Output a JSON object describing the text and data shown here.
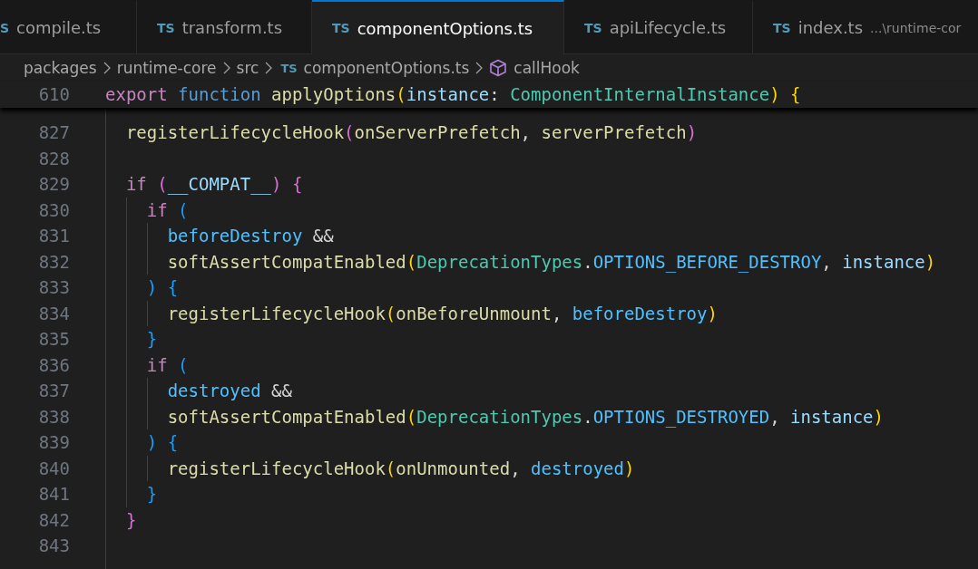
{
  "tabs": [
    {
      "icon": "S",
      "label": "compile.ts",
      "selected": false
    },
    {
      "icon": "TS",
      "label": "transform.ts",
      "selected": false
    },
    {
      "icon": "TS",
      "label": "componentOptions.ts",
      "selected": true
    },
    {
      "icon": "TS",
      "label": "apiLifecycle.ts",
      "selected": false
    },
    {
      "icon": "TS",
      "label": "index.ts",
      "description": "...\\runtime-cor",
      "selected": false
    }
  ],
  "breadcrumbs": [
    {
      "kind": "folder",
      "label": "packages"
    },
    {
      "kind": "folder",
      "label": "runtime-core"
    },
    {
      "kind": "folder",
      "label": "src"
    },
    {
      "kind": "file",
      "icon": "TS",
      "label": "componentOptions.ts"
    },
    {
      "kind": "symbol",
      "label": "callHook"
    }
  ],
  "sticky_line": {
    "number": "610",
    "tokens": [
      {
        "text": "export",
        "kind": "keyword"
      },
      {
        "text": " function",
        "kind": "storage"
      },
      {
        "text": " applyOptions",
        "kind": "function"
      },
      {
        "text": "(",
        "kind": "bracket1"
      },
      {
        "text": "instance",
        "kind": "variable"
      },
      {
        "text": ": ",
        "kind": "plain"
      },
      {
        "text": "ComponentInternalInstance",
        "kind": "type"
      },
      {
        "text": ")",
        "kind": "bracket1"
      },
      {
        "text": " {",
        "kind": "bracket1"
      }
    ]
  },
  "lines": [
    {
      "number": "827",
      "tokens": [
        {
          "text": "  registerLifecycleHook",
          "kind": "function"
        },
        {
          "text": "(",
          "kind": "bracket2"
        },
        {
          "text": "onServerPrefetch",
          "kind": "function"
        },
        {
          "text": ", ",
          "kind": "plain"
        },
        {
          "text": "serverPrefetch",
          "kind": "function"
        },
        {
          "text": ")",
          "kind": "bracket2"
        }
      ]
    },
    {
      "number": "828"
    },
    {
      "number": "829",
      "tokens": [
        {
          "text": "  if",
          "kind": "keyword"
        },
        {
          "text": " (",
          "kind": "bracket2"
        },
        {
          "text": "__COMPAT__",
          "kind": "variable"
        },
        {
          "text": ")",
          "kind": "bracket2"
        },
        {
          "text": " {",
          "kind": "bracket2"
        }
      ]
    },
    {
      "number": "830",
      "tokens": [
        {
          "text": "    if",
          "kind": "keyword"
        },
        {
          "text": " (",
          "kind": "bracket3"
        }
      ]
    },
    {
      "number": "831",
      "tokens": [
        {
          "text": "      beforeDestroy",
          "kind": "constant"
        },
        {
          "text": " &&",
          "kind": "plain"
        }
      ]
    },
    {
      "number": "832",
      "tokens": [
        {
          "text": "      softAssertCompatEnabled",
          "kind": "function"
        },
        {
          "text": "(",
          "kind": "bracket1"
        },
        {
          "text": "DeprecationTypes",
          "kind": "type"
        },
        {
          "text": ".",
          "kind": "plain"
        },
        {
          "text": "OPTIONS_BEFORE_DESTROY",
          "kind": "constant"
        },
        {
          "text": ", ",
          "kind": "plain"
        },
        {
          "text": "instance",
          "kind": "variable"
        },
        {
          "text": ")",
          "kind": "bracket1"
        }
      ]
    },
    {
      "number": "833",
      "tokens": [
        {
          "text": "    )",
          "kind": "bracket3"
        },
        {
          "text": " {",
          "kind": "bracket3"
        }
      ]
    },
    {
      "number": "834",
      "tokens": [
        {
          "text": "      registerLifecycleHook",
          "kind": "function"
        },
        {
          "text": "(",
          "kind": "bracket1"
        },
        {
          "text": "onBeforeUnmount",
          "kind": "function"
        },
        {
          "text": ", ",
          "kind": "plain"
        },
        {
          "text": "beforeDestroy",
          "kind": "constant"
        },
        {
          "text": ")",
          "kind": "bracket1"
        }
      ]
    },
    {
      "number": "835",
      "tokens": [
        {
          "text": "    }",
          "kind": "bracket3"
        }
      ]
    },
    {
      "number": "836",
      "tokens": [
        {
          "text": "    if",
          "kind": "keyword"
        },
        {
          "text": " (",
          "kind": "bracket3"
        }
      ]
    },
    {
      "number": "837",
      "tokens": [
        {
          "text": "      destroyed",
          "kind": "constant"
        },
        {
          "text": " &&",
          "kind": "plain"
        }
      ]
    },
    {
      "number": "838",
      "tokens": [
        {
          "text": "      softAssertCompatEnabled",
          "kind": "function"
        },
        {
          "text": "(",
          "kind": "bracket1"
        },
        {
          "text": "DeprecationTypes",
          "kind": "type"
        },
        {
          "text": ".",
          "kind": "plain"
        },
        {
          "text": "OPTIONS_DESTROYED",
          "kind": "constant"
        },
        {
          "text": ", ",
          "kind": "plain"
        },
        {
          "text": "instance",
          "kind": "variable"
        },
        {
          "text": ")",
          "kind": "bracket1"
        }
      ]
    },
    {
      "number": "839",
      "tokens": [
        {
          "text": "    )",
          "kind": "bracket3"
        },
        {
          "text": " {",
          "kind": "bracket3"
        }
      ]
    },
    {
      "number": "840",
      "tokens": [
        {
          "text": "      registerLifecycleHook",
          "kind": "function"
        },
        {
          "text": "(",
          "kind": "bracket1"
        },
        {
          "text": "onUnmounted",
          "kind": "function"
        },
        {
          "text": ", ",
          "kind": "plain"
        },
        {
          "text": "destroyed",
          "kind": "constant"
        },
        {
          "text": ")",
          "kind": "bracket1"
        }
      ]
    },
    {
      "number": "841",
      "tokens": [
        {
          "text": "    }",
          "kind": "bracket3"
        }
      ]
    },
    {
      "number": "842",
      "tokens": [
        {
          "text": "  }",
          "kind": "bracket2"
        }
      ]
    },
    {
      "number": "843"
    }
  ]
}
